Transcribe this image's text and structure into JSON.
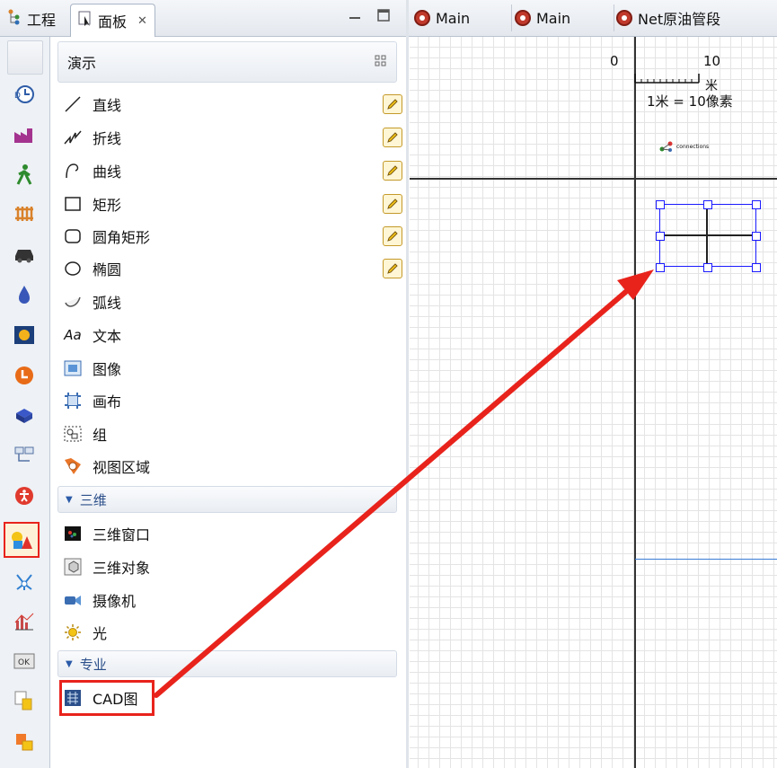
{
  "left_tabs": {
    "project": "工程",
    "palette": "面板"
  },
  "palette": {
    "section_presentation": "演示",
    "items": [
      "直线",
      "折线",
      "曲线",
      "矩形",
      "圆角矩形",
      "椭圆",
      "弧线",
      "文本",
      "图像",
      "画布",
      "组",
      "视图区域"
    ],
    "section_3d": "三维",
    "items_3d": [
      "三维窗口",
      "三维对象",
      "摄像机",
      "光"
    ],
    "section_special": "专业",
    "items_special": [
      "CAD图"
    ]
  },
  "editor": {
    "tabs": [
      "Main",
      "Main",
      "Net原油管段"
    ],
    "scale": {
      "zero": "0",
      "ten": "10",
      "unit": "米",
      "ratio": "1米 = 10像素"
    },
    "connections_label": "connections"
  },
  "colors": {
    "highlight_red": "#e8231c",
    "selection_blue": "#1a1aff",
    "frame_blue": "#3a7bd5"
  }
}
